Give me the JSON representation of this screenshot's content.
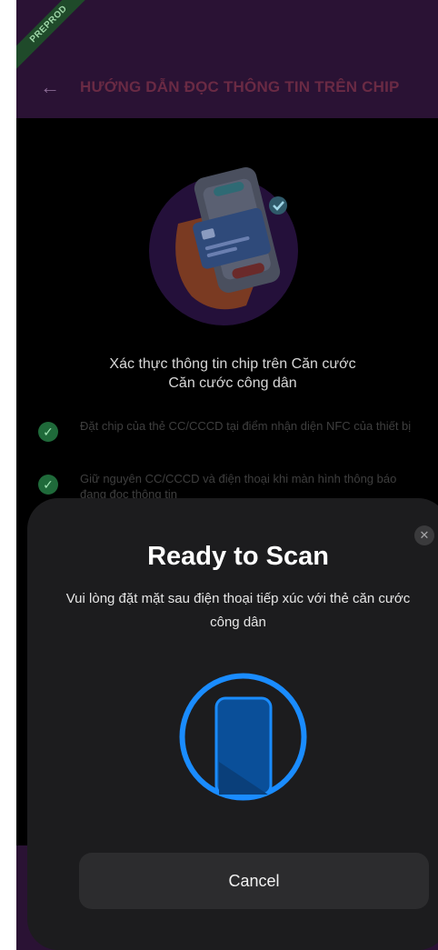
{
  "badge": "PREPROD",
  "header": {
    "back_icon": "arrow-left-icon",
    "title": "HƯỚNG DẪN ĐỌC THÔNG TIN TRÊN CHIP"
  },
  "content": {
    "title_line1": "Xác thực thông tin chip trên Căn cước",
    "title_line2": "Căn cước công dân",
    "steps": [
      {
        "text": "Đặt chip của thẻ CC/CCCD tại điểm nhận diện NFC của thiết bị"
      },
      {
        "text": "Giữ nguyên CC/CCCD và điện thoại khi màn hình thông báo đang đọc thông tin"
      }
    ]
  },
  "sheet": {
    "title": "Ready to Scan",
    "subtitle": "Vui lòng đặt mặt sau điện thoại tiếp xúc với thẻ căn cước công dân",
    "cancel_label": "Cancel",
    "close_icon": "close-icon",
    "scan_icon": "phone-scan-icon"
  },
  "colors": {
    "accent_blue": "#1a8cff",
    "header_bg": "#2a1234",
    "sheet_bg": "#1c1c1e",
    "check_green": "#1f6a3a"
  }
}
